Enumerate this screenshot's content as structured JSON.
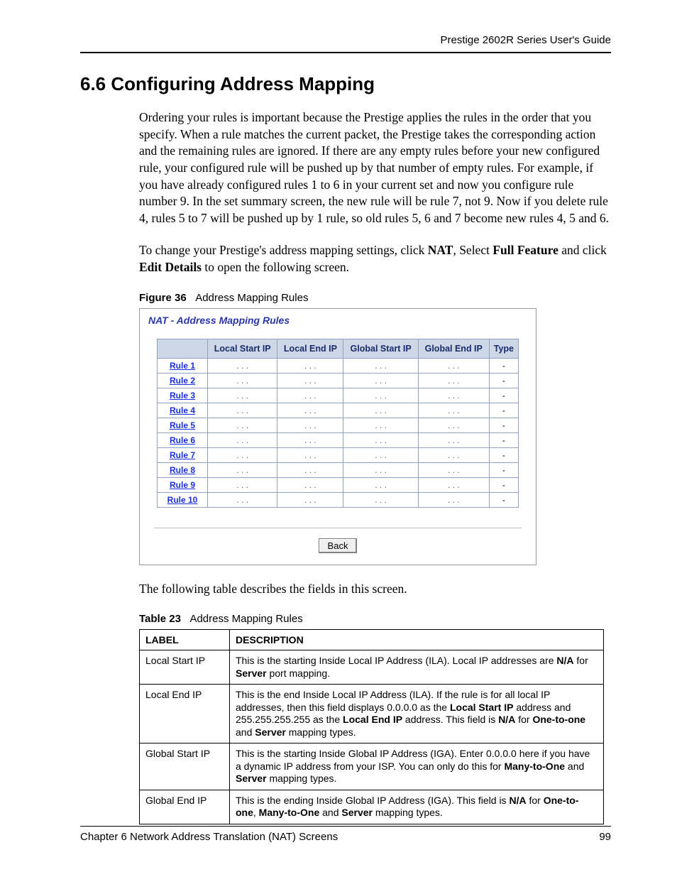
{
  "header": {
    "running": "Prestige 2602R Series User's Guide"
  },
  "section": {
    "heading": "6.6  Configuring Address Mapping"
  },
  "paragraphs": {
    "p1": "Ordering your rules is important because the Prestige applies the rules in the order that you specify. When a rule matches the current packet, the Prestige takes the corresponding action and the remaining rules are ignored. If there are any empty rules before your new configured rule, your configured rule will be pushed up by that number of empty rules. For example, if you have already configured rules 1 to 6 in your current set and now you configure rule number 9. In the set summary screen, the new rule will be rule 7, not 9. Now if you delete rule 4, rules 5 to 7 will be pushed up by 1 rule, so old rules 5, 6 and 7 become new rules 4, 5 and 6.",
    "p2_pre": "To change your Prestige's address mapping settings, click ",
    "p2_b1": "NAT",
    "p2_mid1": ", Select ",
    "p2_b2": "Full Feature",
    "p2_mid2": " and click ",
    "p2_b3": "Edit Details",
    "p2_post": " to open the following screen.",
    "p3": "The following table describes the fields in this screen."
  },
  "figure": {
    "label": "Figure 36",
    "title": "Address Mapping Rules",
    "screenshot_title": "NAT - Address Mapping Rules",
    "columns": {
      "c0": "",
      "c1": "Local Start IP",
      "c2": "Local End IP",
      "c3": "Global Start IP",
      "c4": "Global End IP",
      "c5": "Type"
    },
    "rows": [
      {
        "name": "Rule 1",
        "c1": ". . .",
        "c2": ". . .",
        "c3": ". . .",
        "c4": ". . .",
        "c5": "-"
      },
      {
        "name": "Rule 2",
        "c1": ". . .",
        "c2": ". . .",
        "c3": ". . .",
        "c4": ". . .",
        "c5": "-"
      },
      {
        "name": "Rule 3",
        "c1": ". . .",
        "c2": ". . .",
        "c3": ". . .",
        "c4": ". . .",
        "c5": "-"
      },
      {
        "name": "Rule 4",
        "c1": ". . .",
        "c2": ". . .",
        "c3": ". . .",
        "c4": ". . .",
        "c5": "-"
      },
      {
        "name": "Rule 5",
        "c1": ". . .",
        "c2": ". . .",
        "c3": ". . .",
        "c4": ". . .",
        "c5": "-"
      },
      {
        "name": "Rule 6",
        "c1": ". . .",
        "c2": ". . .",
        "c3": ". . .",
        "c4": ". . .",
        "c5": "-"
      },
      {
        "name": "Rule 7",
        "c1": ". . .",
        "c2": ". . .",
        "c3": ". . .",
        "c4": ". . .",
        "c5": "-"
      },
      {
        "name": "Rule 8",
        "c1": ". . .",
        "c2": ". . .",
        "c3": ". . .",
        "c4": ". . .",
        "c5": "-"
      },
      {
        "name": "Rule 9",
        "c1": ". . .",
        "c2": ". . .",
        "c3": ". . .",
        "c4": ". . .",
        "c5": "-"
      },
      {
        "name": "Rule 10",
        "c1": ". . .",
        "c2": ". . .",
        "c3": ". . .",
        "c4": ". . .",
        "c5": "-"
      }
    ],
    "back_label": "Back"
  },
  "table": {
    "label": "Table 23",
    "title": "Address Mapping Rules",
    "headers": {
      "h1": "LABEL",
      "h2": "DESCRIPTION"
    },
    "rows": {
      "r1": {
        "label": "Local Start IP",
        "d_pre": "This is the starting Inside Local IP Address (ILA). Local IP addresses are ",
        "d_b1": "N/A",
        "d_mid1": " for ",
        "d_b2": "Server",
        "d_post": " port mapping."
      },
      "r2": {
        "label": "Local End IP",
        "d_pre": "This is the end Inside Local IP Address (ILA). If the rule is for all local IP addresses, then this field displays 0.0.0.0 as the ",
        "d_b1": "Local Start IP",
        "d_mid1": " address and 255.255.255.255 as the ",
        "d_b2": "Local End IP",
        "d_mid2": " address. This field is ",
        "d_b3": "N/A",
        "d_mid3": " for ",
        "d_b4": "One-to-one",
        "d_mid4": " and ",
        "d_b5": "Server",
        "d_post": " mapping types."
      },
      "r3": {
        "label": "Global Start IP",
        "d_pre": "This is the starting Inside Global IP Address (IGA). Enter 0.0.0.0 here if you have a dynamic IP address from your ISP. You can only do this for ",
        "d_b1": "Many-to-One",
        "d_mid1": " and ",
        "d_b2": "Server",
        "d_post": " mapping types."
      },
      "r4": {
        "label": "Global End IP",
        "d_pre": "This is the ending Inside Global IP Address (IGA). This field is ",
        "d_b1": "N/A",
        "d_mid1": " for ",
        "d_b2": "One-to-one",
        "d_mid2": ", ",
        "d_b3": "Many-to-One",
        "d_mid3": " and ",
        "d_b4": "Server",
        "d_post": " mapping types."
      }
    }
  },
  "footer": {
    "chapter": "Chapter 6 Network Address Translation (NAT) Screens",
    "page": "99"
  }
}
